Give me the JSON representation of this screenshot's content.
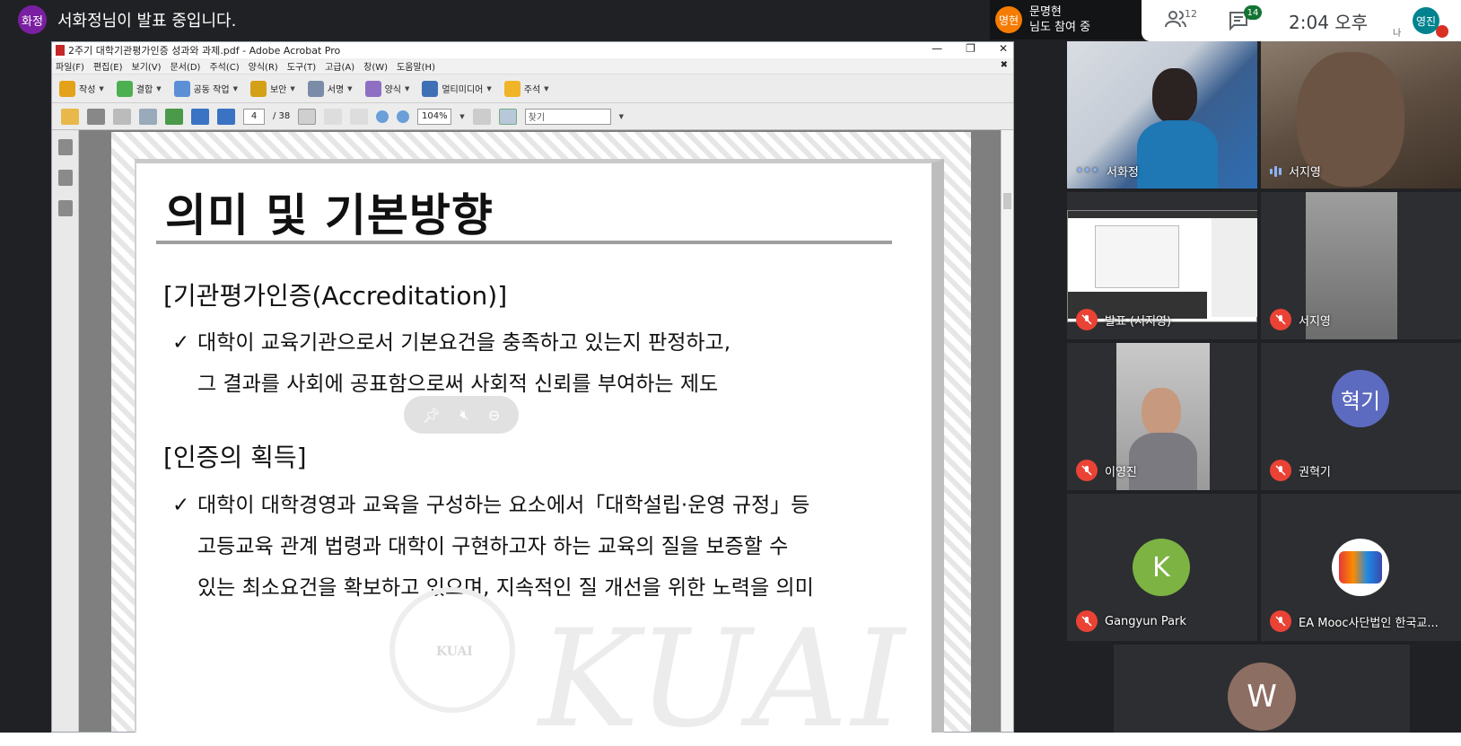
{
  "banner": {
    "presenter_initials": "화정",
    "text": "서화정님이 발표 중입니다."
  },
  "join_notice": {
    "initials": "명현",
    "name": "문명현",
    "text": "님도 참여 중"
  },
  "topbar": {
    "people_count": "12",
    "chat_count": "14",
    "time": "2:04  오후",
    "self_initials": "영진",
    "self_label": "나"
  },
  "acrobat": {
    "title": "2주기 대학기관평가인증 성과와 과제.pdf - Adobe Acrobat Pro",
    "menu": [
      "파일(F)",
      "편집(E)",
      "보기(V)",
      "문서(D)",
      "주석(C)",
      "양식(R)",
      "도구(T)",
      "고급(A)",
      "창(W)",
      "도움말(H)"
    ],
    "toolbar": [
      "작성",
      "결합",
      "공동 작업",
      "보안",
      "서명",
      "양식",
      "멀티미디어",
      "주석"
    ],
    "page_current": "4",
    "page_total": "/ 38",
    "zoom": "104%",
    "find_placeholder": "찾기"
  },
  "slide": {
    "title": "의미 및 기본방향",
    "section1": "[기관평가인증(Accreditation)]",
    "bullet1_line1": "대학이 교육기관으로서 기본요건을 충족하고 있는지 판정하고,",
    "bullet1_line2": "그 결과를 사회에 공표함으로써 사회적 신뢰를 부여하는 제도",
    "section2": "[인증의 획득]",
    "bullet2_line1": "대학이 대학경영과 교육을 구성하는 요소에서「대학설립·운영 규정」등",
    "bullet2_line2": "고등교육 관계 법령과 대학이 구현하고자 하는 교육의 질을 보증할 수",
    "bullet2_line3": "있는 최소요건을 확보하고 있으며, 지속적인 질 개선을 위한 노력을 의미",
    "check": "✓",
    "watermark": "KUAI",
    "seal_text": "KUAI"
  },
  "participants": [
    {
      "name": "서화정"
    },
    {
      "name": "서지영"
    },
    {
      "name": "발표 (서지영)"
    },
    {
      "name": "서지영"
    },
    {
      "name": "이영진"
    },
    {
      "name": "권혁기",
      "initials": "혁기"
    },
    {
      "name": "Gangyun Park",
      "initials": "K"
    },
    {
      "name": "EA Mooc사단법인 한국교..."
    },
    {
      "initials": "W"
    }
  ],
  "colors": {
    "presenter": "#7b1fa2",
    "join": "#f57c00",
    "self": "#00838f",
    "hyukki": "#5c6bc0",
    "gangyun": "#7cb342",
    "w_avatar": "#8d6e63",
    "mic_off": "#ea4335"
  }
}
